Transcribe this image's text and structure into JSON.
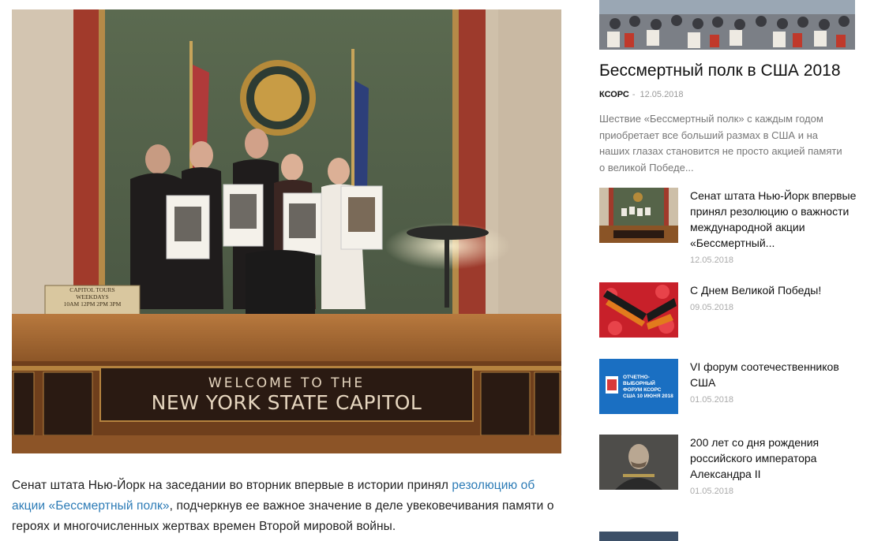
{
  "main": {
    "photo": {
      "desk_sign_line1": "WELCOME TO THE",
      "desk_sign_line2": "NEW YORK STATE CAPITOL",
      "tours_sign": [
        "CAPITOL TOURS",
        "WEEKDAYS",
        "10AM  12PM  2PM  3PM"
      ],
      "colors": {
        "wall": "#5f6a52",
        "pillar": "#c9b9a4",
        "curtain": "#a0392b",
        "desk": "#8a5426",
        "desk_top": "#b3773b",
        "sign_bg": "#2a1a12",
        "sign_text": "#e6d6bf"
      }
    },
    "caption": {
      "before": "Сенат штата Нью-Йорк на заседании во вторник впервые в истории принял ",
      "link": "резолюцию об акции «Бессмертный полк»",
      "after": ", подчеркнув ее важное значение в деле увековечивания памяти о героях и многочисленных жертвах времен Второй мировой войны.",
      "link_color": "#2c7bb6"
    }
  },
  "sidebar": {
    "featured": {
      "title": "Бессмертный полк в США 2018",
      "author": "КСОРС",
      "separator": "-",
      "date": "12.05.2018",
      "excerpt": "Шествие «Бессмертный полк» с каждым годом приобретает все больший размах в США и на наших глазах становится не просто акцией памяти о великой Победе..."
    },
    "items": [
      {
        "title": "Сенат штата Нью-Йорк впервые принял резолюцию о важности международной акции «Бессмертный...",
        "date": "12.05.2018"
      },
      {
        "title": "С Днем Великой Победы!",
        "date": "09.05.2018"
      },
      {
        "title": "VI форум соотечественников США",
        "date": "01.05.2018",
        "thumb_text": "ОТЧЕТНО-ВЫБОРНЫЙ ФОРУМ КСОРС США 10 ИЮНЯ 2018"
      },
      {
        "title": "200 лет со дня рождения российского императора Александра II",
        "date": "01.05.2018"
      }
    ]
  }
}
